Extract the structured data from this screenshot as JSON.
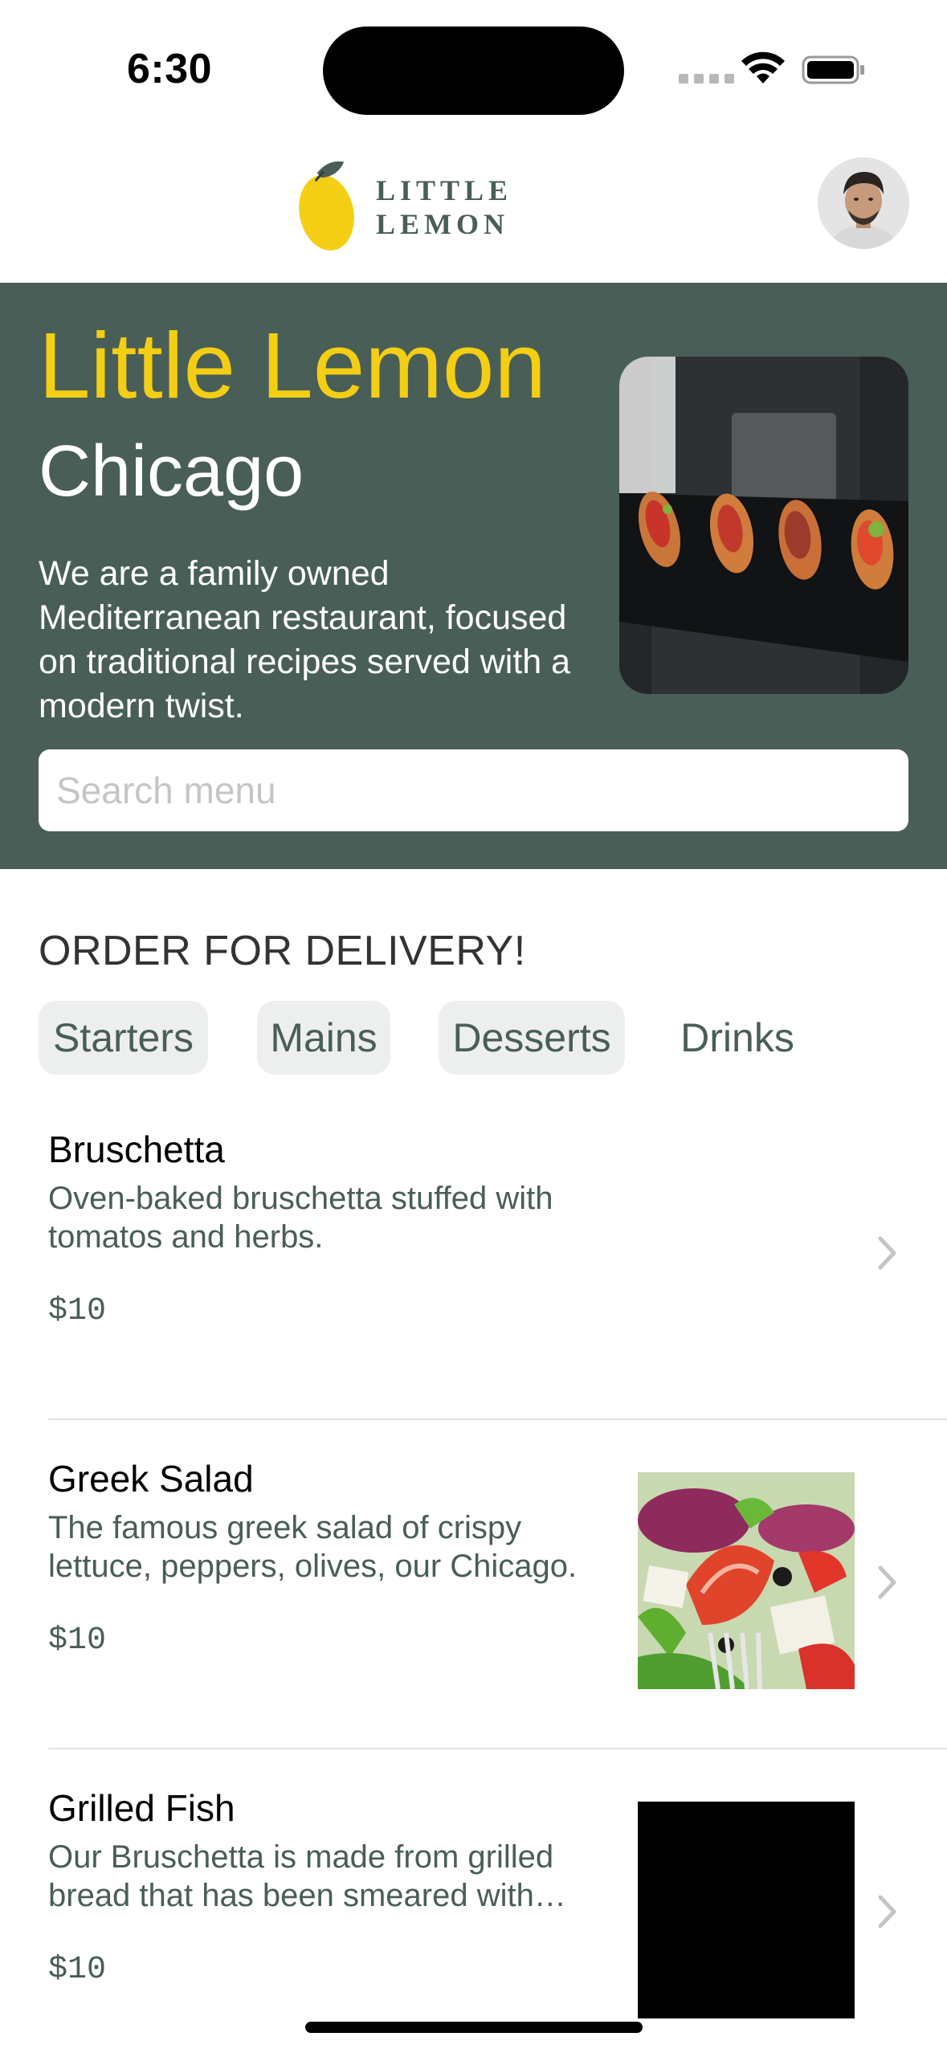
{
  "status_bar": {
    "time": "6:30"
  },
  "header": {
    "logo_text": "LITTLE LEMON",
    "avatar": "profile-avatar"
  },
  "hero": {
    "title": "Little Lemon",
    "city": "Chicago",
    "description": "We are a family owned Mediterranean restaurant, focused on traditional recipes served with a modern twist.",
    "search_placeholder": "Search menu"
  },
  "delivery": {
    "title": "ORDER FOR DELIVERY!",
    "categories": [
      "Starters",
      "Mains",
      "Desserts",
      "Drinks"
    ]
  },
  "menu": [
    {
      "name": "Bruschetta",
      "description": "Oven-baked bruschetta stuffed with tomatos and herbs.",
      "price": "$10",
      "image": "none"
    },
    {
      "name": "Greek Salad",
      "description": "The famous greek salad of crispy lettuce, peppers, olives, our Chicago.",
      "price": "$10",
      "image": "greek-salad-photo"
    },
    {
      "name": "Grilled Fish",
      "description": "Our Bruschetta is made from grilled bread that has been smeared with…",
      "price": "$10",
      "image": "black-placeholder"
    }
  ],
  "colors": {
    "primary_green": "#495e57",
    "primary_yellow": "#f4ce14",
    "chip_bg": "#edefee"
  }
}
